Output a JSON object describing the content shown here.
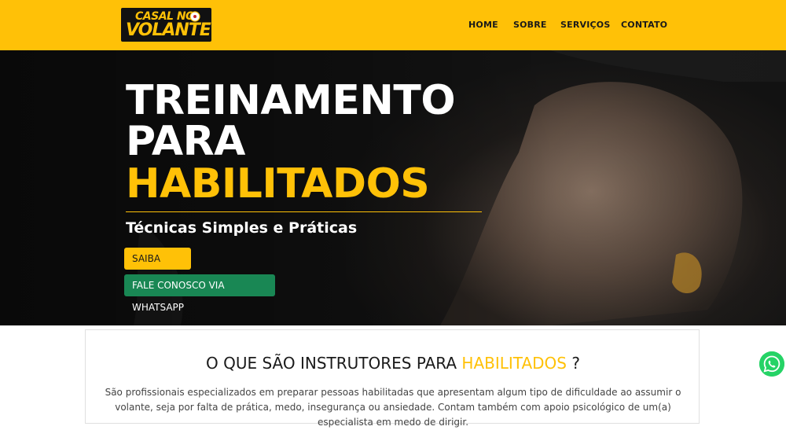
{
  "brand": {
    "logo_top": "CASAL NO",
    "logo_bottom": "VOLANTE",
    "colors": {
      "accent": "#ffc107",
      "dark": "#111111",
      "success": "#198754",
      "whatsapp": "#25d366"
    }
  },
  "nav": {
    "items": [
      {
        "label": "HOME"
      },
      {
        "label": "SOBRE"
      },
      {
        "label": "SERVIÇOS"
      },
      {
        "label": "CONTATO"
      }
    ]
  },
  "hero": {
    "line1": "TREINAMENTO",
    "line2": "PARA",
    "line3": "HABILITADOS",
    "subtitle": "Técnicas Simples e Práticas",
    "cta_primary": "SAIBA MAIS",
    "cta_secondary": "FALE CONOSCO VIA WHATSAPP"
  },
  "section": {
    "title_prefix": "O QUE SÃO INSTRUTORES PARA",
    "title_highlight": "HABILITADOS",
    "title_suffix": "?",
    "text": "São profissionais especializados em preparar pessoas habilitadas que apresentam algum tipo de dificuldade ao assumir o volante, seja por falta de prática, medo, insegurança ou ansiedade. Contam também com apoio psicológico de um(a) especialista em medo de dirigir."
  },
  "floating": {
    "icon": "whatsapp-icon"
  }
}
